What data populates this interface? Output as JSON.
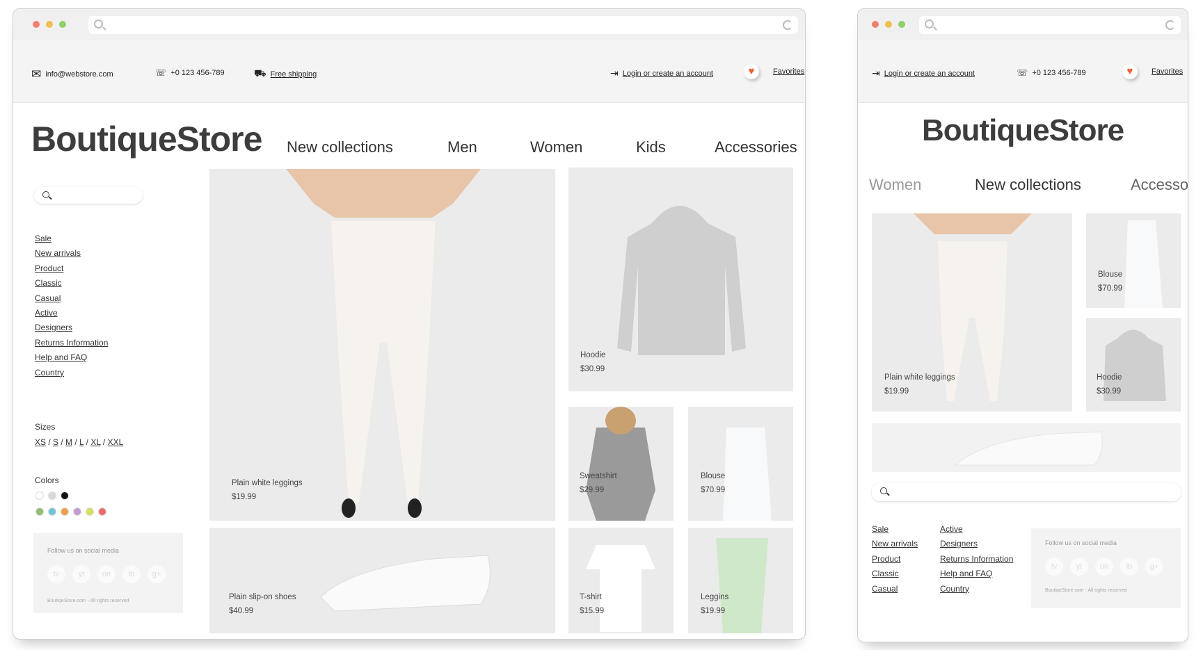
{
  "colors": {
    "accent": "#f06030",
    "logo": "#3d3d3d",
    "tile_bg": "#ebebeb"
  },
  "desktop": {
    "topbar": {
      "email": "info@webstore.com",
      "phone": "+0 123 456-789",
      "shipping": "Free shipping",
      "login": "Login or create an account",
      "favorites": "Favorites"
    },
    "logo": "BoutiqueStore",
    "nav": [
      "New collections",
      "Men",
      "Women",
      "Kids",
      "Accessories"
    ],
    "sidebar": {
      "links": [
        "Sale",
        "New arrivals",
        "Product",
        "Classic",
        "Casual",
        "Active",
        "Designers",
        "Returns Information",
        "Help and FAQ",
        "Country"
      ],
      "sizes_title": "Sizes",
      "sizes": [
        "XS",
        "S",
        "M",
        "L",
        "XL",
        "XXL"
      ],
      "colors_title": "Colors",
      "color_row1": [
        "#ffffff",
        "#d9d9d9",
        "#111111"
      ],
      "color_row2": [
        "#8fbf6f",
        "#6fc3d6",
        "#e8a04a",
        "#c39bd3",
        "#d9de5a",
        "#ef6b6b"
      ],
      "social_title": "Follow us on social media",
      "social": [
        "tv",
        "yt",
        "on",
        "lb",
        "g+"
      ],
      "copyright": "BoutiqeStore.com - All rights reserved"
    },
    "products": [
      {
        "name": "Plain white leggings",
        "price": "$19.99"
      },
      {
        "name": "Hoodie",
        "price": "$30.99"
      },
      {
        "name": "Sweatshirt",
        "price": "$29.99"
      },
      {
        "name": "Blouse",
        "price": "$70.99"
      },
      {
        "name": "Plain slip-on shoes",
        "price": "$40.99"
      },
      {
        "name": "T-shirt",
        "price": "$15.99"
      },
      {
        "name": "Leggins",
        "price": "$19.99"
      }
    ]
  },
  "mobile": {
    "topbar": {
      "login": "Login or create an account",
      "phone": "+0 123 456-789",
      "favorites": "Favorites"
    },
    "logo": "BoutiqueStore",
    "nav": [
      "Women",
      "New collections",
      "Accessories"
    ],
    "products": [
      {
        "name": "Plain white leggings",
        "price": "$19.99"
      },
      {
        "name": "Blouse",
        "price": "$70.99"
      },
      {
        "name": "Hoodie",
        "price": "$30.99"
      }
    ],
    "links_col1": [
      "Sale",
      "New arrivals",
      "Product",
      "Classic",
      "Casual"
    ],
    "links_col2": [
      "Active",
      "Designers",
      "Returns Information",
      "Help and FAQ",
      "Country"
    ],
    "social_title": "Follow us on social media",
    "social": [
      "tv",
      "yt",
      "on",
      "lb",
      "g+"
    ],
    "copyright": "BoutiqeStore.com - All rights reserved"
  }
}
